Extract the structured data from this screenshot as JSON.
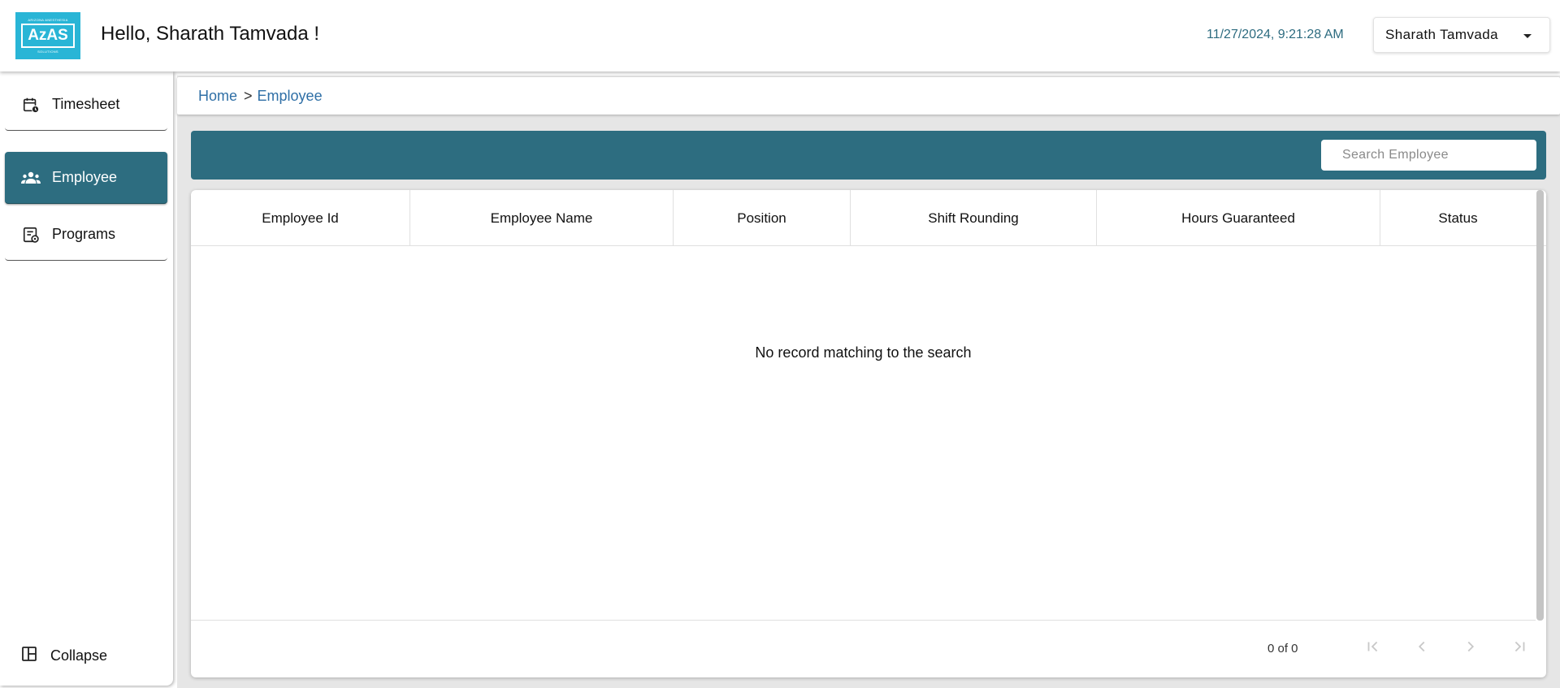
{
  "header": {
    "logo": {
      "top_text": "ARIZONA ANESTHESIA",
      "mark": "AzAS",
      "bottom_text": "SOLUTIONS"
    },
    "greeting": "Hello, Sharath Tamvada !",
    "datetime": "11/27/2024, 9:21:28 AM",
    "user_menu": {
      "name": "Sharath Tamvada",
      "icon": "caret-down-icon"
    }
  },
  "sidebar": {
    "items": [
      {
        "label": "Timesheet",
        "icon": "calendar-clock-icon",
        "active": false
      },
      {
        "label": "Employee",
        "icon": "people-icon",
        "active": true
      },
      {
        "label": "Programs",
        "icon": "program-list-icon",
        "active": false
      }
    ],
    "collapse_label": "Collapse",
    "collapse_icon": "layout-panel-icon"
  },
  "breadcrumb": {
    "home": "Home",
    "separator": ">",
    "current": "Employee"
  },
  "search": {
    "placeholder": "Search Employee",
    "value": ""
  },
  "table": {
    "columns": [
      "Employee Id",
      "Employee Name",
      "Position",
      "Shift Rounding",
      "Hours Guaranteed",
      "Status"
    ],
    "rows": [],
    "empty_message": "No record matching to the search"
  },
  "pagination": {
    "range_text": "0 of 0",
    "buttons": [
      "first-page-icon",
      "previous-page-icon",
      "next-page-icon",
      "last-page-icon"
    ]
  },
  "colors": {
    "primary": "#2d6d80",
    "logo_bg": "#29b5d6",
    "link": "#2f6fa6",
    "background": "#e6e6e6"
  }
}
